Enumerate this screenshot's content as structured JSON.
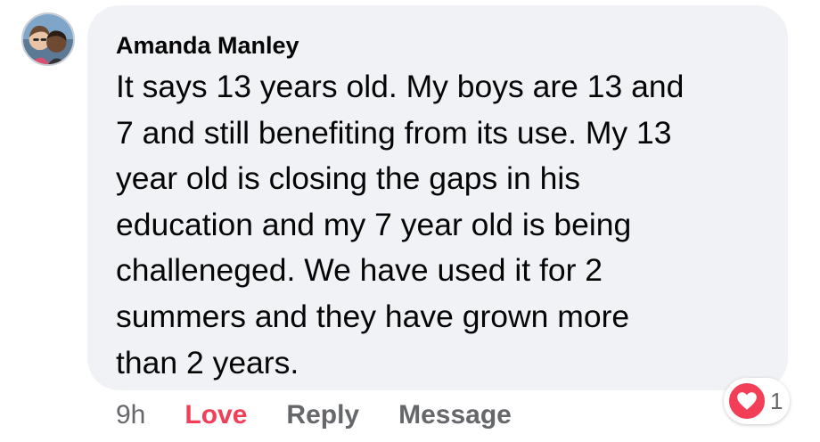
{
  "comment": {
    "author": "Amanda Manley",
    "text": "It says 13 years old. My boys are 13 and\n7 and still benefiting from its use. My 13\nyear old is closing the gaps in his\neducation and my 7 year old is being\nchalleneged. We have used it for 2\nsummers and they have grown more\nthan  2 years.",
    "avatar_icon": "profile-photo"
  },
  "actions": {
    "time": "9h",
    "love_label": "Love",
    "reply_label": "Reply",
    "message_label": "Message"
  },
  "reactions": {
    "icon": "heart-icon",
    "count": "1"
  },
  "colors": {
    "bubble": "#f0f2f5",
    "love": "#f33e58",
    "muted": "#65676b",
    "text": "#050505"
  }
}
